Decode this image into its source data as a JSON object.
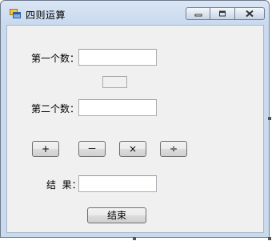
{
  "window": {
    "title": "四则运算",
    "icon": "windows-forms-app-icon",
    "controls": {
      "minimize": "minimize-icon",
      "maximize": "maximize-icon",
      "close": "close-icon"
    }
  },
  "form": {
    "first_label": "第一个数：",
    "first_value": "",
    "operator_display": "",
    "second_label": "第二个数：",
    "second_value": "",
    "result_label": "结  果：",
    "result_value": ""
  },
  "buttons": {
    "add": "+",
    "subtract": "－",
    "multiply": "×",
    "divide": "÷",
    "end": "结束"
  },
  "colors": {
    "titlebar": "#c9d9ee",
    "client": "#f0f0f0"
  }
}
